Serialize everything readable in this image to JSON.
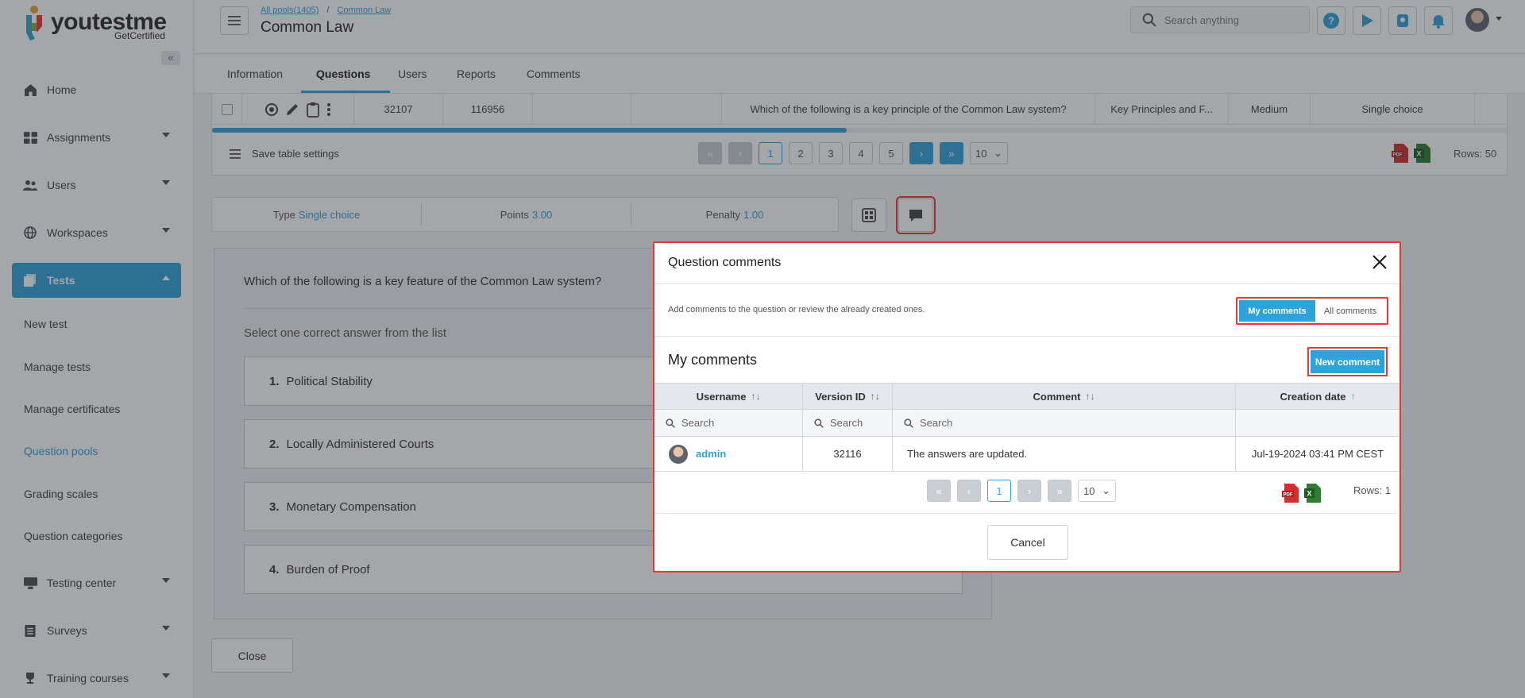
{
  "app": {
    "logo_text": "youtestme",
    "logo_sub": "GetCertified",
    "collapse_icon": "«"
  },
  "sidebar": {
    "items": [
      {
        "label": "Home",
        "icon": "home-icon"
      },
      {
        "label": "Assignments",
        "icon": "assignments-icon"
      },
      {
        "label": "Users",
        "icon": "users-icon"
      },
      {
        "label": "Workspaces",
        "icon": "globe-icon"
      },
      {
        "label": "Tests",
        "icon": "tests-icon",
        "active": true
      }
    ],
    "tests_sub": [
      "New test",
      "Manage tests",
      "Manage certificates",
      "Question pools",
      "Grading scales",
      "Question categories"
    ],
    "bottom_items": [
      {
        "label": "Testing center",
        "icon": "testing-center-icon"
      },
      {
        "label": "Surveys",
        "icon": "surveys-icon"
      },
      {
        "label": "Training courses",
        "icon": "trophy-icon"
      }
    ]
  },
  "header": {
    "breadcrumb": [
      "All pools(1405)",
      "Common Law"
    ],
    "breadcrumb_sep": "/",
    "title": "Common Law",
    "search_placeholder": "Search anything"
  },
  "tabs": [
    "Information",
    "Questions",
    "Users",
    "Reports",
    "Comments"
  ],
  "active_tab": "Questions",
  "bg_table": {
    "row": {
      "id": "32107",
      "version": "116956",
      "question": "Which of the following is a key principle of the Common Law system?",
      "category": "Key Principles and F...",
      "difficulty": "Medium",
      "type": "Single choice"
    },
    "scroll_fraction": 0.49,
    "save_settings": "Save table settings",
    "pages": [
      "1",
      "2",
      "3",
      "4",
      "5"
    ],
    "current_page": "1",
    "page_size": "10",
    "rows": "Rows: 50"
  },
  "question_info": {
    "type_label": "Type",
    "type_value": "Single choice",
    "points_label": "Points",
    "points_value": "3.00",
    "penalty_label": "Penalty",
    "penalty_value": "1.00"
  },
  "question": {
    "text": "Which of the following is a key feature of the Common Law system?",
    "hint": "Select one correct answer from the list",
    "answers": [
      {
        "num": "1.",
        "text": "Political Stability"
      },
      {
        "num": "2.",
        "text": "Locally Administered Courts"
      },
      {
        "num": "3.",
        "text": "Monetary Compensation"
      },
      {
        "num": "4.",
        "text": "Burden of Proof"
      }
    ],
    "close_label": "Close"
  },
  "modal": {
    "title": "Question comments",
    "description": "Add comments to the question or review the already created ones.",
    "toggle": {
      "mine": "My comments",
      "all": "All comments"
    },
    "subtitle": "My comments",
    "new_comment": "New comment",
    "columns": [
      "Username",
      "Version ID",
      "Comment",
      "Creation date"
    ],
    "search_placeholder": "Search",
    "rows": [
      {
        "username": "admin",
        "version": "32116",
        "comment": "The answers are updated.",
        "date": "Jul-19-2024 03:41 PM CEST"
      }
    ],
    "page": "1",
    "page_size": "10",
    "rows_label": "Rows: 1",
    "cancel": "Cancel"
  },
  "colors": {
    "accent": "#2fa2db",
    "highlight": "#e53935",
    "pdf": "#d32f2f",
    "excel": "#1e7e34"
  }
}
